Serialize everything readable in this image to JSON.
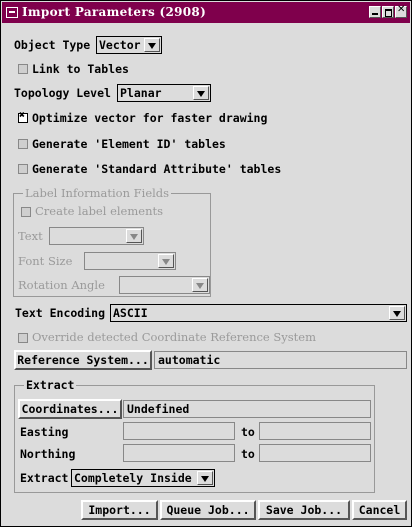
{
  "window": {
    "title": "Import Parameters (2908)",
    "title_bg": "#7f004c"
  },
  "object_type": {
    "label": "Object Type",
    "value": "Vector"
  },
  "link_tables": {
    "label": "Link to Tables",
    "checked": false
  },
  "topology": {
    "label": "Topology Level",
    "value": "Planar"
  },
  "optimize": {
    "label": "Optimize vector for faster drawing",
    "checked": true
  },
  "gen_element_id": {
    "label": "Generate 'Element ID' tables",
    "checked": false
  },
  "gen_std_attr": {
    "label": "Generate 'Standard Attribute' tables",
    "checked": false
  },
  "label_info": {
    "title": "Label Information Fields",
    "create_label": "Create label elements",
    "text_label": "Text",
    "font_size_label": "Font Size",
    "rotation_label": "Rotation Angle"
  },
  "text_encoding": {
    "label": "Text Encoding",
    "value": "ASCII"
  },
  "override_crs": {
    "label": "Override detected Coordinate Reference System"
  },
  "reference_system": {
    "button": "Reference System...",
    "value": "automatic"
  },
  "extract": {
    "title": "Extract",
    "coordinates_button": "Coordinates...",
    "coordinates_value": "Undefined",
    "easting_label": "Easting",
    "northing_label": "Northing",
    "to_label": "to",
    "extract_label": "Extract",
    "extract_value": "Completely Inside"
  },
  "buttons": {
    "import": "Import...",
    "queue": "Queue Job...",
    "save": "Save Job...",
    "cancel": "Cancel"
  }
}
